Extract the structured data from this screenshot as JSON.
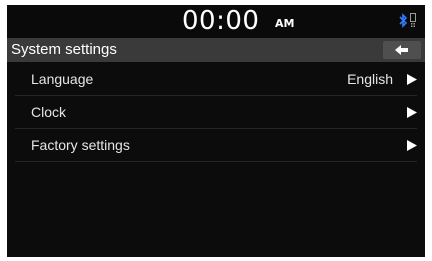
{
  "status_bar": {
    "time": "00:00",
    "ampm": "AM",
    "icons": [
      "bluetooth-icon",
      "phone-icon"
    ]
  },
  "header": {
    "title": "System settings",
    "back_icon": "back-arrow-icon"
  },
  "menu": {
    "items": [
      {
        "label": "Language",
        "value": "English",
        "icon": "chevron-right-icon"
      },
      {
        "label": "Clock",
        "value": "",
        "icon": "chevron-right-icon"
      },
      {
        "label": "Factory settings",
        "value": "",
        "icon": "chevron-right-icon"
      }
    ]
  },
  "colors": {
    "background": "#0c0c0c",
    "title_bar": "#3a3a3a",
    "bluetooth": "#2f7dff",
    "text": "#ffffff"
  }
}
